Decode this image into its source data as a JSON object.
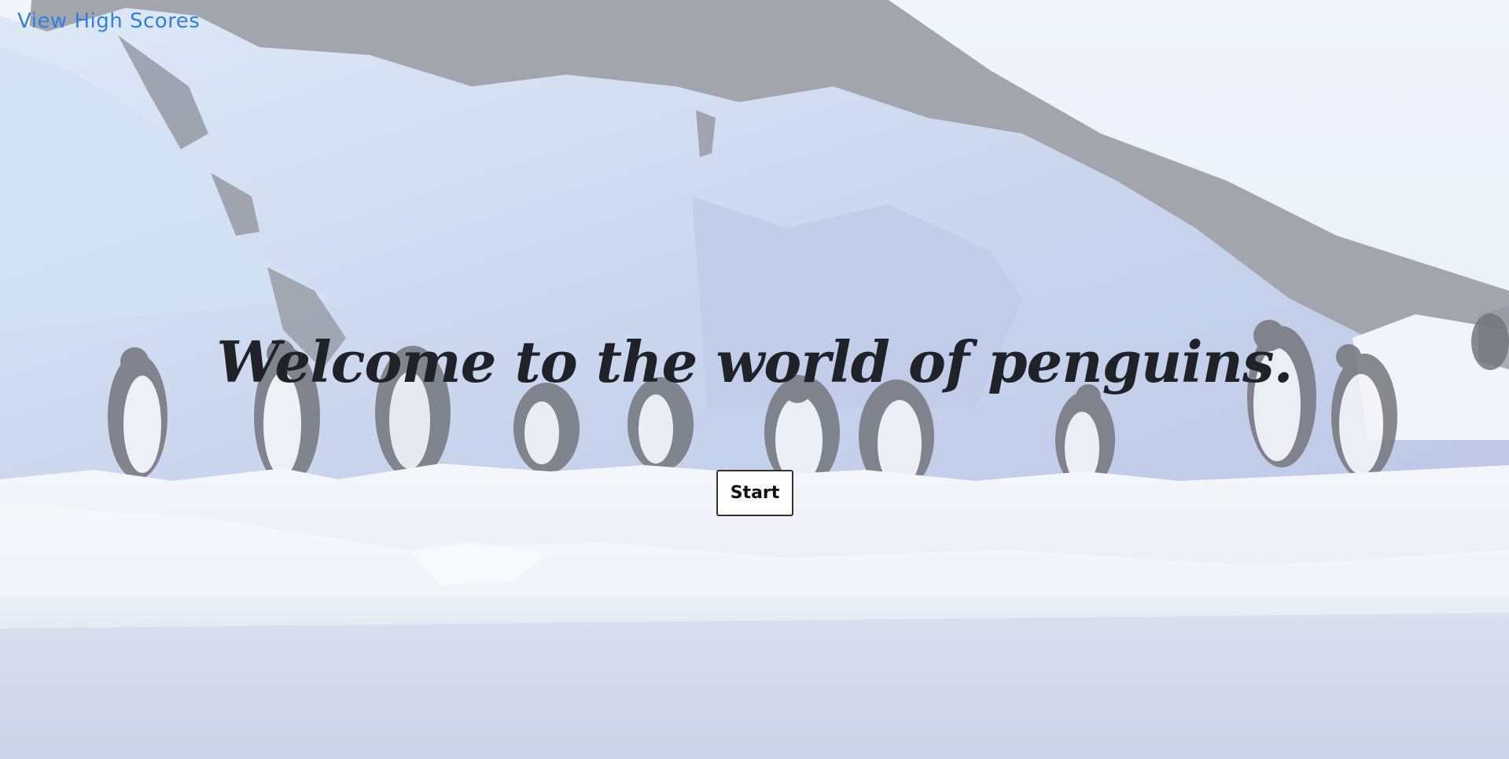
{
  "header": {
    "high_scores_link": "View High Scores"
  },
  "main": {
    "headline": "Welcome to the world of penguins.",
    "start_button": "Start"
  },
  "background": {
    "subject": "penguins standing on ice"
  },
  "colors": {
    "link": "#2f7fe8",
    "headline": "#1f2328",
    "button_border": "#3a3028",
    "button_bg": "#ffffff"
  }
}
